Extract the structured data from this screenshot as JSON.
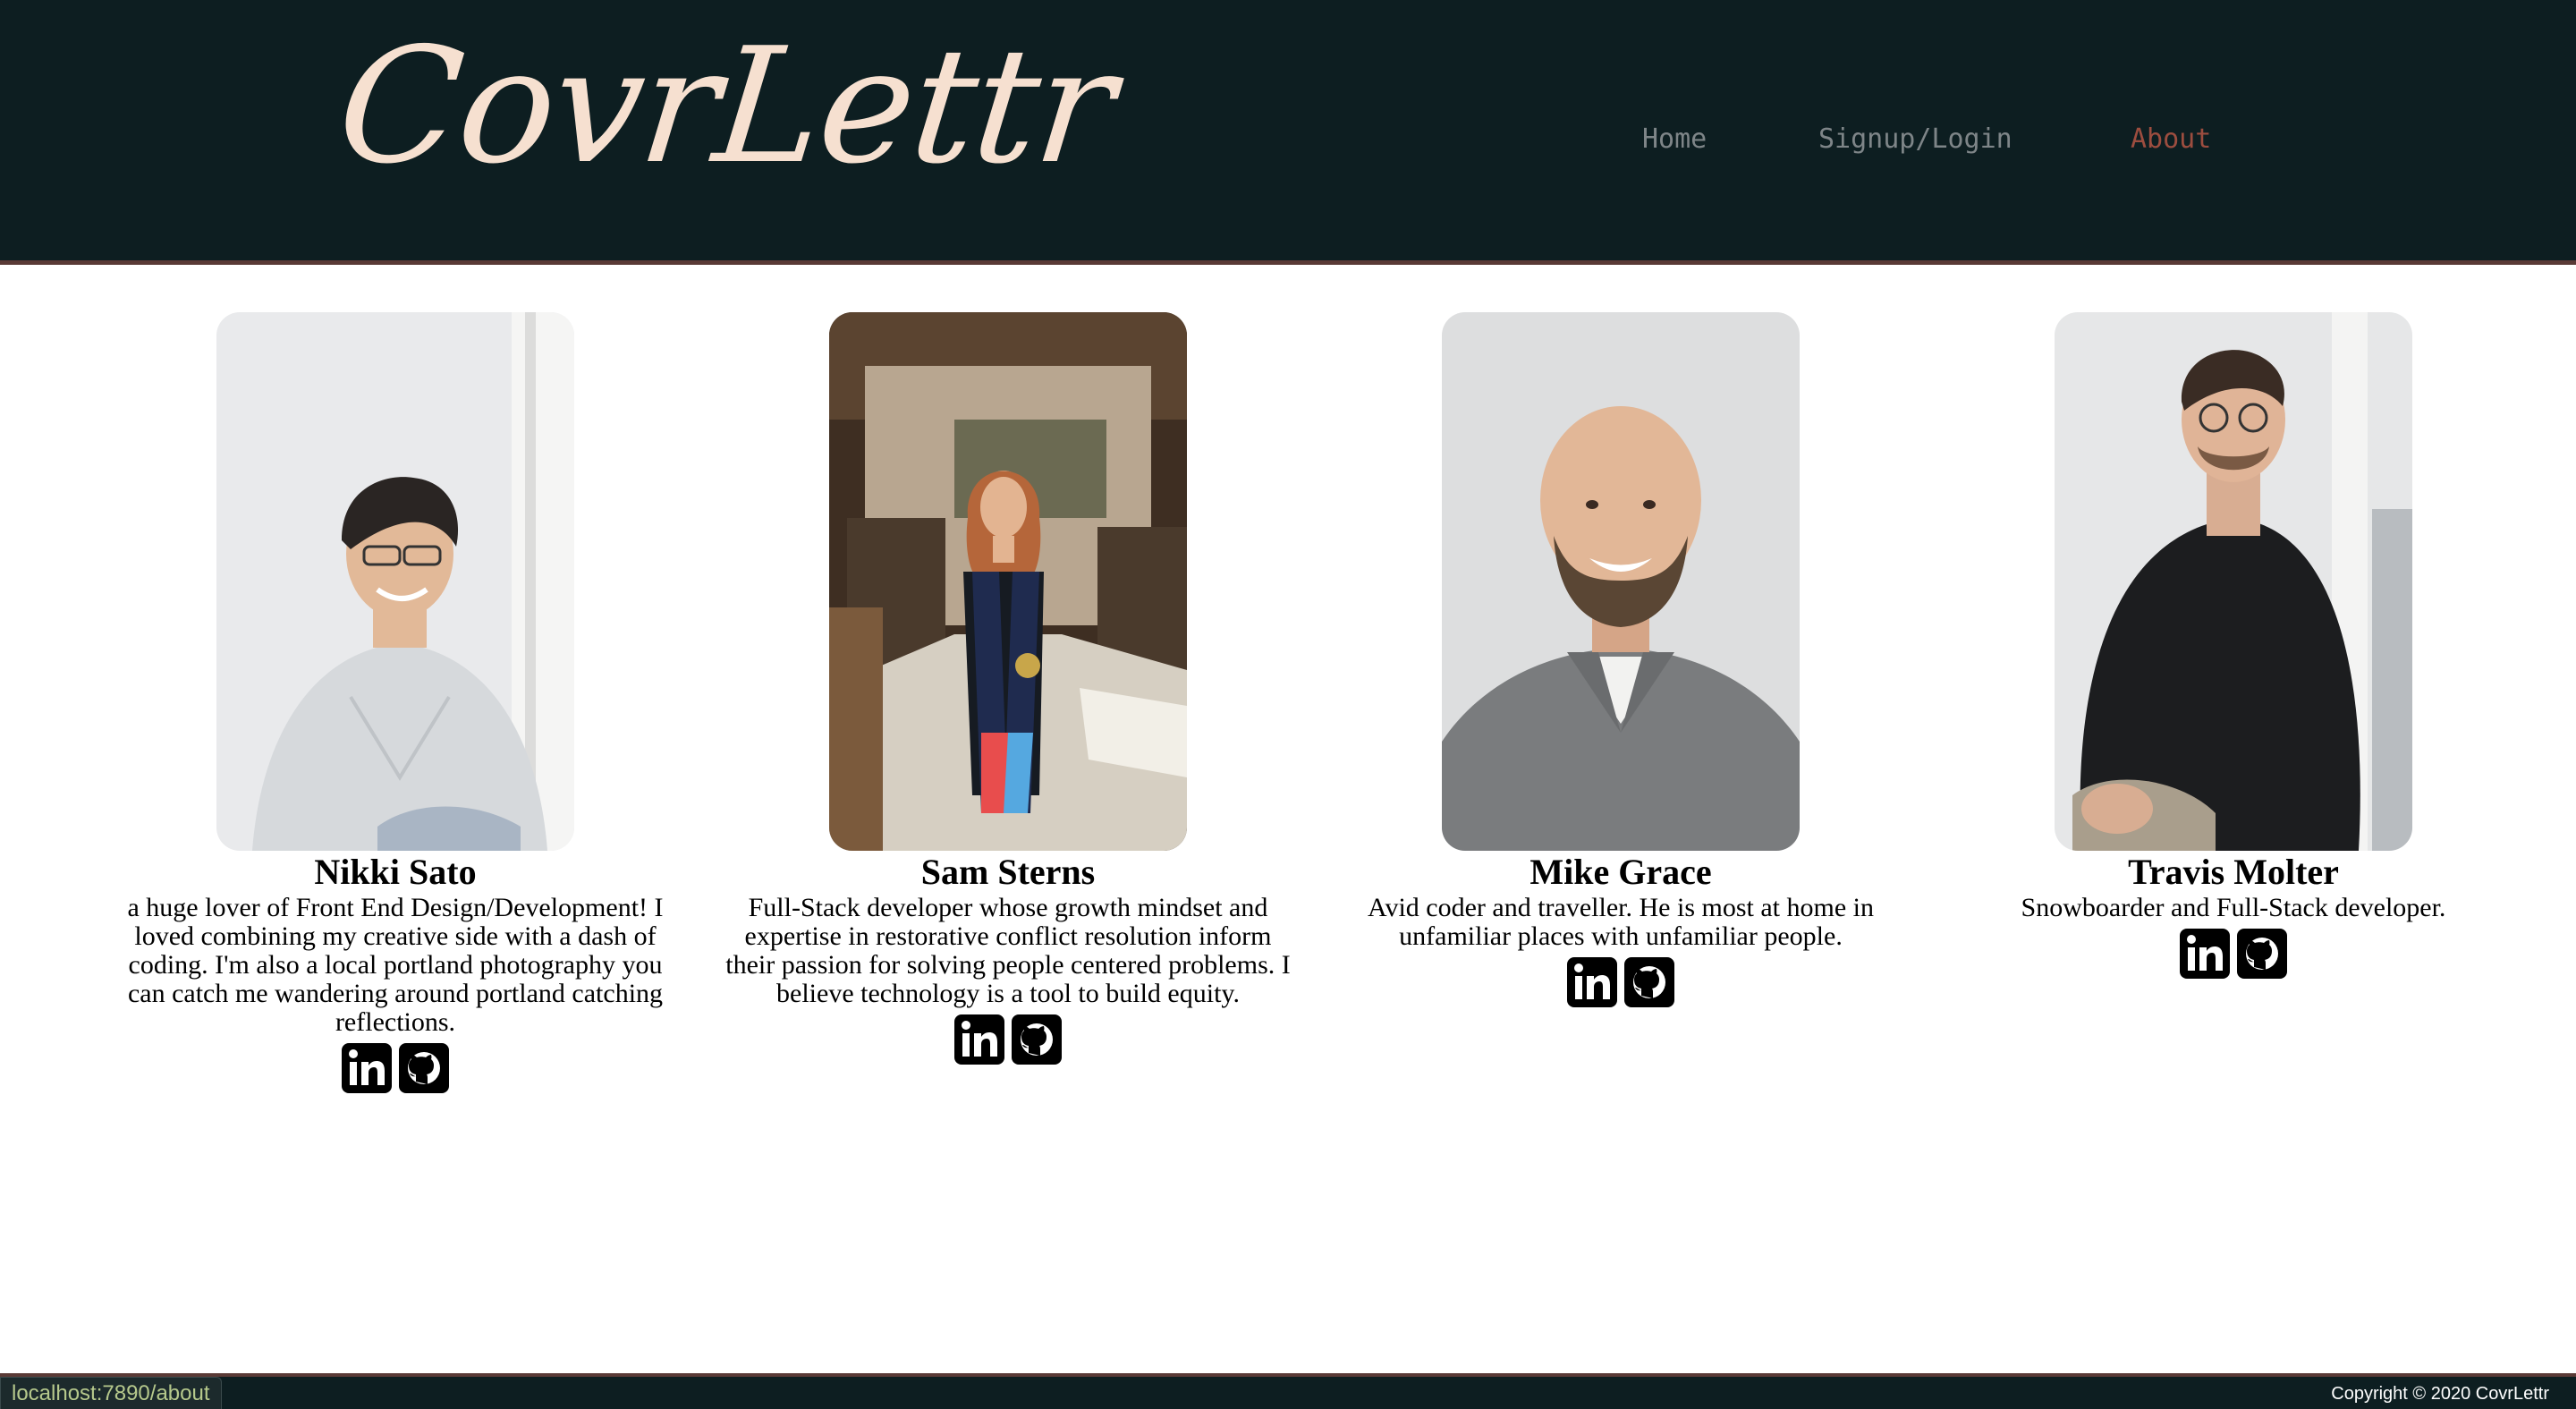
{
  "header": {
    "logo": "CovrLettr",
    "nav": [
      {
        "label": "Home",
        "active": false
      },
      {
        "label": "Signup/Login",
        "active": false
      },
      {
        "label": "About",
        "active": true
      }
    ]
  },
  "team": [
    {
      "name": "Nikki Sato",
      "bio": "a huge lover of Front End Design/Development! I loved combining my creative side with a dash of coding. I'm also a local portland photography you can catch me wandering around portland catching reflections.",
      "photo_icon": "portrait-photo"
    },
    {
      "name": "Sam Sterns",
      "bio": "Full-Stack developer whose growth mindset and expertise in restorative conflict resolution inform their passion for solving people centered problems. I believe technology is a tool to build equity.",
      "photo_icon": "portrait-photo"
    },
    {
      "name": "Mike Grace",
      "bio": "Avid coder and traveller. He is most at home in unfamiliar places with unfamiliar people.",
      "photo_icon": "portrait-photo"
    },
    {
      "name": "Travis Molter",
      "bio": "Snowboarder and Full-Stack developer.",
      "photo_icon": "portrait-photo"
    }
  ],
  "social_icons": [
    "linkedin-icon",
    "github-icon"
  ],
  "footer": {
    "copyright": "Copyright © 2020 CovrLettr"
  },
  "status_bar": {
    "url": "localhost:7890/about"
  },
  "colors": {
    "header_bg": "#0d1e21",
    "logo": "#f6e0d0",
    "nav_link": "#7e8588",
    "nav_active": "#9c4d3f",
    "border_accent": "#5a3a36"
  }
}
